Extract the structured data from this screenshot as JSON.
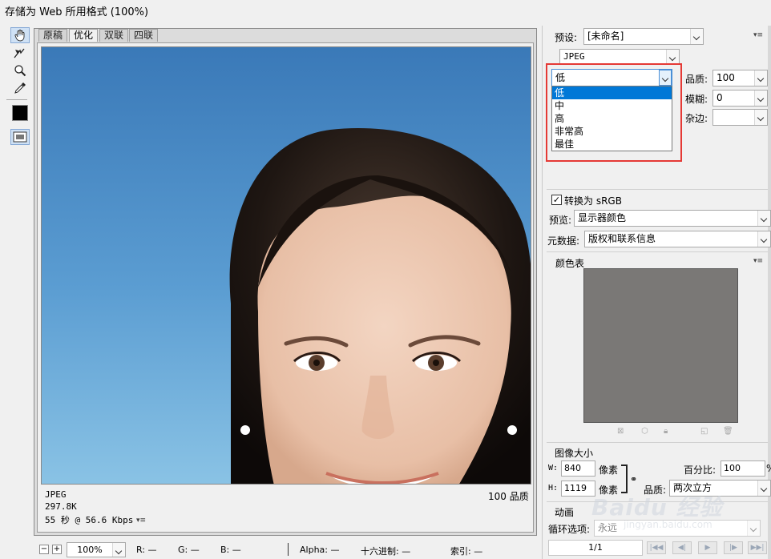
{
  "window": {
    "title": "存储为 Web 所用格式 (100%)"
  },
  "tools": [
    "hand-tool",
    "slice-select-tool",
    "zoom-tool",
    "eyedropper-tool",
    "eyedropper-color",
    "toggle-slices"
  ],
  "tabs": [
    "原稿",
    "优化",
    "双联",
    "四联"
  ],
  "active_tab": "优化",
  "image_info": {
    "format": "JPEG",
    "size": "297.8K",
    "time": "55 秒 @ 56.6 Kbps",
    "quality": "100 品质"
  },
  "status_bar": {
    "zoom": "100%",
    "r_label": "R:",
    "r_value": "—",
    "g_label": "G:",
    "g_value": "—",
    "b_label": "B:",
    "b_value": "—",
    "alpha_label": "Alpha:",
    "alpha_value": "—",
    "hex_label": "十六进制:",
    "hex_value": "—",
    "index_label": "索引:",
    "index_value": "—"
  },
  "settings": {
    "preset_label": "预设:",
    "preset_value": "[未命名]",
    "format_value": "JPEG",
    "quality_preset_value": "低",
    "quality_label": "品质:",
    "quality_value": "100",
    "blur_label": "模糊:",
    "blur_value": "0",
    "matte_label": "杂边:",
    "matte_value": "",
    "convert_srgb_label": "转换为 sRGB",
    "convert_srgb_checked": true,
    "preview_label": "预览:",
    "preview_value": "显示器颜色",
    "metadata_label": "元数据:",
    "metadata_value": "版权和联系信息"
  },
  "quality_dropdown": {
    "options": [
      "低",
      "中",
      "高",
      "非常高",
      "最佳"
    ],
    "highlighted": "低",
    "highlight_color": "#e53935"
  },
  "color_table": {
    "title": "颜色表",
    "swatch_color": "#7a7876"
  },
  "image_size": {
    "title": "图像大小",
    "w_label": "W:",
    "w_value": "840",
    "h_label": "H:",
    "h_value": "1119",
    "unit": "像素",
    "percent_label": "百分比:",
    "percent_value": "100",
    "percent_unit": "%",
    "quality_label": "品质:",
    "quality_value": "两次立方"
  },
  "animation": {
    "title": "动画",
    "loop_label": "循环选项:",
    "loop_value": "永远",
    "frame_counter": "1/1"
  },
  "watermark": {
    "text": "Baidu 经验",
    "subtext": "jingyan.baidu.com"
  }
}
